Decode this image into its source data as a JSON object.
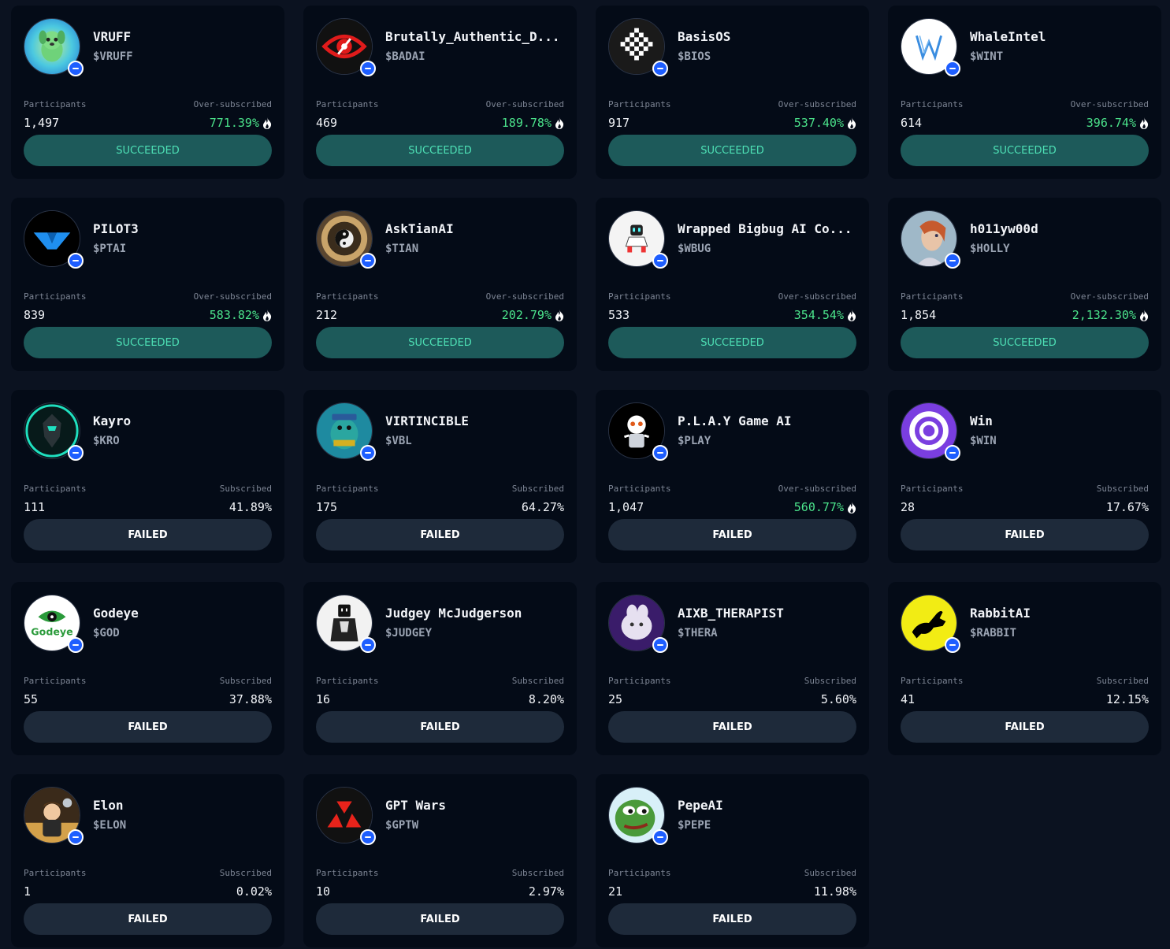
{
  "labels": {
    "participants": "Participants"
  },
  "colors": {
    "background": "#0b1220",
    "card": "#040b17",
    "success_text": "#4be38b",
    "succeeded_button": "#1d5a5a",
    "failed_button": "#1e2a3a",
    "chain_badge": "#1e5eff"
  },
  "cards": [
    {
      "name": "VRUFF",
      "ticker": "$VRUFF",
      "participants": "1,497",
      "sub_label": "Over-subscribed",
      "sub_value": "771.39%",
      "status": "SUCCEEDED",
      "icon": "dog-avatar-icon"
    },
    {
      "name": "Brutally_Authentic_D...",
      "ticker": "$BADAI",
      "participants": "469",
      "sub_label": "Over-subscribed",
      "sub_value": "189.78%",
      "status": "SUCCEEDED",
      "icon": "red-eye-avatar-icon"
    },
    {
      "name": "BasisOS",
      "ticker": "$BIOS",
      "participants": "917",
      "sub_label": "Over-subscribed",
      "sub_value": "537.40%",
      "status": "SUCCEEDED",
      "icon": "checker-diamond-avatar-icon"
    },
    {
      "name": "WhaleIntel",
      "ticker": "$WINT",
      "participants": "614",
      "sub_label": "Over-subscribed",
      "sub_value": "396.74%",
      "status": "SUCCEEDED",
      "icon": "w-logo-avatar-icon"
    },
    {
      "name": "PILOT3",
      "ticker": "$PTAI",
      "participants": "839",
      "sub_label": "Over-subscribed",
      "sub_value": "583.82%",
      "status": "SUCCEEDED",
      "icon": "blue-v-avatar-icon"
    },
    {
      "name": "AskTianAI",
      "ticker": "$TIAN",
      "participants": "212",
      "sub_label": "Over-subscribed",
      "sub_value": "202.79%",
      "status": "SUCCEEDED",
      "icon": "yin-yang-avatar-icon"
    },
    {
      "name": "Wrapped Bigbug AI Co...",
      "ticker": "$WBUG",
      "participants": "533",
      "sub_label": "Over-subscribed",
      "sub_value": "354.54%",
      "status": "SUCCEEDED",
      "icon": "robot-avatar-icon"
    },
    {
      "name": "h011yw00d",
      "ticker": "$HOLLY",
      "participants": "1,854",
      "sub_label": "Over-subscribed",
      "sub_value": "2,132.30%",
      "status": "SUCCEEDED",
      "icon": "portrait-avatar-icon"
    },
    {
      "name": "Kayro",
      "ticker": "$KRO",
      "participants": "111",
      "sub_label": "Subscribed",
      "sub_value": "41.89%",
      "status": "FAILED",
      "icon": "armor-avatar-icon"
    },
    {
      "name": "VIRTINCIBLE",
      "ticker": "$VBL",
      "participants": "175",
      "sub_label": "Subscribed",
      "sub_value": "64.27%",
      "status": "FAILED",
      "icon": "bear-avatar-icon"
    },
    {
      "name": "P.L.A.Y Game AI",
      "ticker": "$PLAY",
      "participants": "1,047",
      "sub_label": "Over-subscribed",
      "sub_value": "560.77%",
      "status": "FAILED",
      "icon": "game-character-avatar-icon"
    },
    {
      "name": "Win",
      "ticker": "$WIN",
      "participants": "28",
      "sub_label": "Subscribed",
      "sub_value": "17.67%",
      "status": "FAILED",
      "icon": "purple-ring-avatar-icon"
    },
    {
      "name": "Godeye",
      "ticker": "$GOD",
      "participants": "55",
      "sub_label": "Subscribed",
      "sub_value": "37.88%",
      "status": "FAILED",
      "icon": "green-eye-avatar-icon"
    },
    {
      "name": "Judgey McJudgerson",
      "ticker": "$JUDGEY",
      "participants": "16",
      "sub_label": "Subscribed",
      "sub_value": "8.20%",
      "status": "FAILED",
      "icon": "judge-avatar-icon"
    },
    {
      "name": "AIXB_THERAPIST",
      "ticker": "$THERA",
      "participants": "25",
      "sub_label": "Subscribed",
      "sub_value": "5.60%",
      "status": "FAILED",
      "icon": "purple-creature-avatar-icon"
    },
    {
      "name": "RabbitAI",
      "ticker": "$RABBIT",
      "participants": "41",
      "sub_label": "Subscribed",
      "sub_value": "12.15%",
      "status": "FAILED",
      "icon": "rabbit-avatar-icon"
    },
    {
      "name": "Elon",
      "ticker": "$ELON",
      "participants": "1",
      "sub_label": "Subscribed",
      "sub_value": "0.02%",
      "status": "FAILED",
      "icon": "elon-avatar-icon"
    },
    {
      "name": "GPT Wars",
      "ticker": "$GPTW",
      "participants": "10",
      "sub_label": "Subscribed",
      "sub_value": "2.97%",
      "status": "FAILED",
      "icon": "red-triangles-avatar-icon"
    },
    {
      "name": "PepeAI",
      "ticker": "$PEPE",
      "participants": "21",
      "sub_label": "Subscribed",
      "sub_value": "11.98%",
      "status": "FAILED",
      "icon": "pepe-avatar-icon"
    }
  ]
}
